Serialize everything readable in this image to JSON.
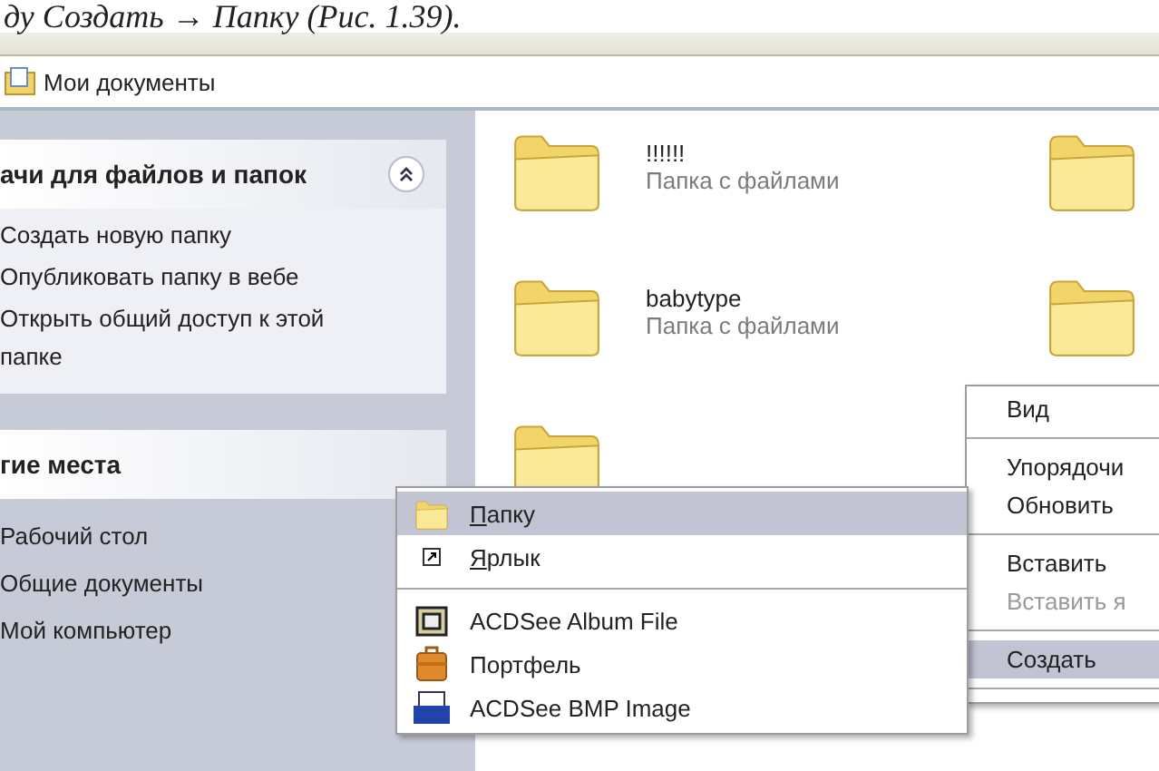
{
  "caption": "ду Создать → Папку (Рис. 1.39).",
  "address": {
    "title": "Мои документы"
  },
  "sidebar": {
    "panels": [
      {
        "title": "ачи для файлов и папок",
        "expanded": true,
        "boxed": true,
        "items": [
          "Создать новую папку",
          "Опубликовать папку в вебе",
          "Открыть общий доступ к этой папке"
        ]
      },
      {
        "title": "гие места",
        "expanded": false,
        "boxed": false,
        "items": [
          "Рабочий стол",
          "Общие документы",
          "Мой компьютер"
        ]
      }
    ]
  },
  "files": [
    {
      "kind": "folder",
      "name": "!!!!!!",
      "type": "Папка с файлами"
    },
    {
      "kind": "folder"
    },
    {
      "kind": "folder",
      "name": "babytype",
      "type": "Папка с файлами"
    },
    {
      "kind": "folder"
    },
    {
      "kind": "folder"
    }
  ],
  "context_menu": {
    "items": [
      {
        "kind": "item",
        "label": "Вид",
        "disabled": false,
        "selected": false
      },
      {
        "kind": "separator"
      },
      {
        "kind": "item",
        "label": "Упорядочи",
        "disabled": false,
        "selected": false
      },
      {
        "kind": "item",
        "label": "Обновить",
        "disabled": false,
        "selected": false
      },
      {
        "kind": "separator"
      },
      {
        "kind": "item",
        "label": "Вставить",
        "disabled": false,
        "selected": false
      },
      {
        "kind": "item",
        "label": "Вставить я",
        "disabled": true,
        "selected": false
      },
      {
        "kind": "separator"
      },
      {
        "kind": "item",
        "label": "Создать",
        "disabled": false,
        "selected": true
      },
      {
        "kind": "separator"
      }
    ]
  },
  "submenu": {
    "items": [
      {
        "kind": "folder",
        "label": "Папку",
        "underline_first": true,
        "selected": true
      },
      {
        "kind": "shortcut",
        "label": "Ярлык",
        "underline_first": true,
        "selected": false
      },
      {
        "kind": "separator"
      },
      {
        "kind": "album",
        "label": "ACDSee Album File",
        "underline_first": false,
        "selected": false
      },
      {
        "kind": "briefcase",
        "label": "Портфель",
        "underline_first": false,
        "selected": false
      },
      {
        "kind": "bmp",
        "label": "ACDSee BMP Image",
        "underline_first": false,
        "selected": false
      }
    ]
  }
}
